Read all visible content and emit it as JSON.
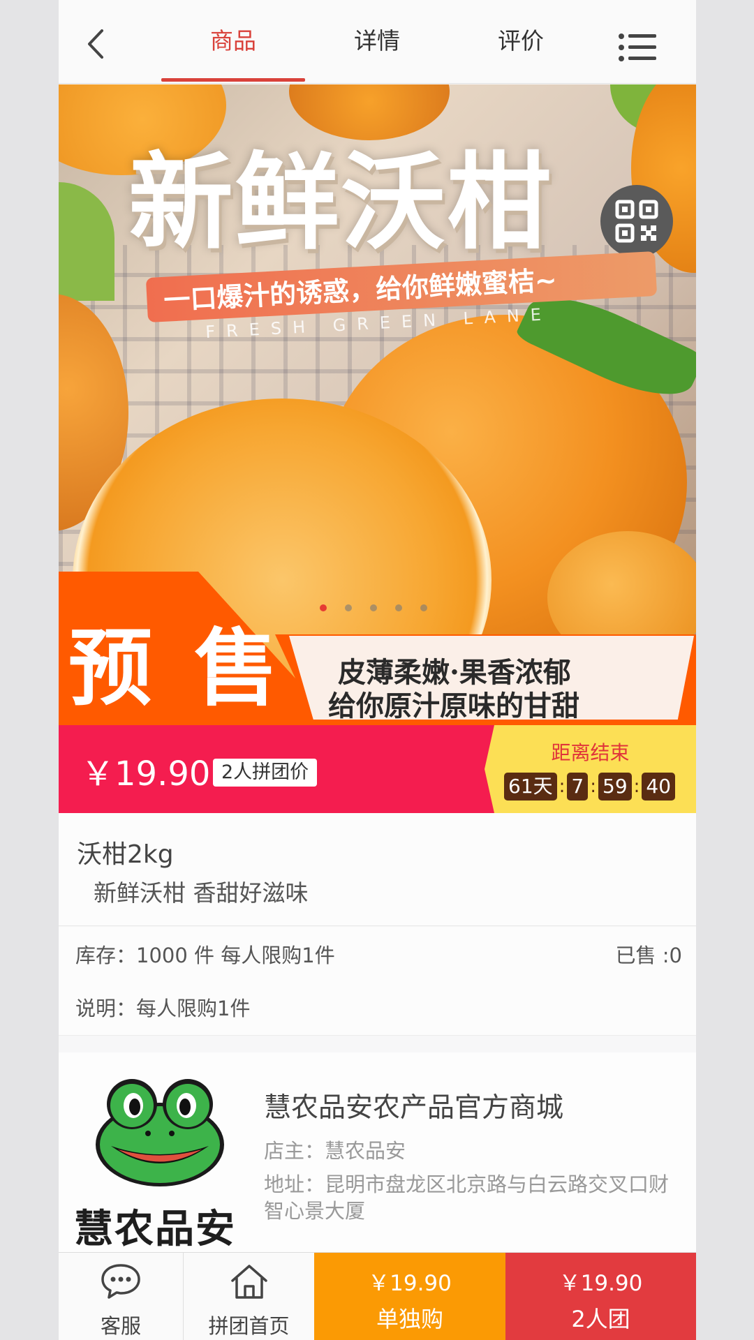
{
  "header": {
    "tabs": [
      {
        "label": "商品",
        "active": true
      },
      {
        "label": "详情",
        "active": false
      },
      {
        "label": "评价",
        "active": false
      }
    ],
    "icons": {
      "back": "chevron-left-icon",
      "menu": "list-menu-icon"
    },
    "accent_color": "#d9413a"
  },
  "banner": {
    "title": "新鲜沃柑",
    "subtitle": "一口爆汁的诱惑，给你鲜嫩蜜桔~",
    "english": "FRESH GREEN LANE",
    "presale": "预售",
    "slogan_line1": "皮薄柔嫩·果香浓郁",
    "slogan_line2": "给你原汁原味的甘甜",
    "slide_count": 5,
    "active_slide": 0
  },
  "price_bar": {
    "price": "￥19.90",
    "group_tag": "2人拼团价",
    "countdown_title": "距离结束",
    "days": "61天",
    "hours": "7",
    "minutes": "59",
    "seconds": "40",
    "bg_color": "#f41d4f",
    "countdown_bg": "#fcdf55"
  },
  "product": {
    "title": "沃柑2kg",
    "subtitle": "新鲜沃柑 香甜好滋味",
    "stock": "库存：1000 件 每人限购1件",
    "sold": "已售 :0",
    "description": "说明：每人限购1件"
  },
  "store": {
    "logo_text": "慧农品安",
    "name": "慧农品安农产品官方商城",
    "owner": "店主：慧农品安",
    "address": "地址：昆明市盘龙区北京路与白云路交叉口财智心景大厦"
  },
  "bottom_bar": {
    "service_label": "客服",
    "home_label": "拼团首页",
    "alone_price": "￥19.90",
    "alone_label": "单独购",
    "group_price": "￥19.90",
    "group_label": "2人团",
    "alone_color": "#fb9a04",
    "group_color": "#e23b3f"
  }
}
